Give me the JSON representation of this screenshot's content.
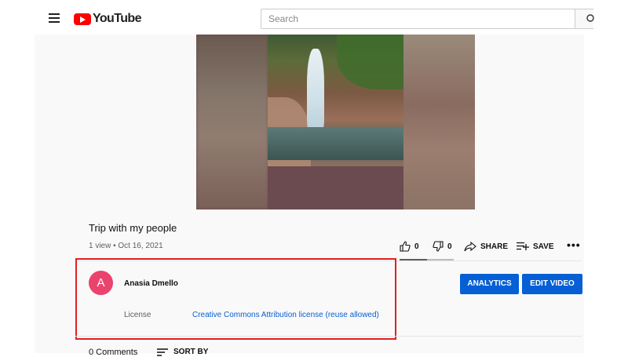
{
  "header": {
    "logo_text": "YouTube",
    "search_placeholder": "Search"
  },
  "video": {
    "title": "Trip with my people",
    "meta": "1 view • Oct 16, 2021",
    "likes": "0",
    "dislikes": "0",
    "share_label": "SHARE",
    "save_label": "SAVE",
    "more_label": "•••",
    "like_ratio": 0.5
  },
  "channel": {
    "avatar_letter": "A",
    "avatar_color": "#e9436e",
    "name": "Anasia Dmello",
    "analytics_label": "ANALYTICS",
    "edit_label": "EDIT VIDEO",
    "license_label": "License",
    "license_value": "Creative Commons Attribution license (reuse allowed)"
  },
  "comments": {
    "count_label": "0 Comments",
    "sort_label": "SORT BY"
  },
  "colors": {
    "accent": "#065fd4",
    "highlight": "#e02020",
    "brand": "#ff0000"
  },
  "icons": [
    "menu-icon",
    "youtube-logo-icon",
    "search-icon",
    "like-icon",
    "dislike-icon",
    "share-icon",
    "save-playlist-icon",
    "more-icon",
    "sort-icon"
  ]
}
